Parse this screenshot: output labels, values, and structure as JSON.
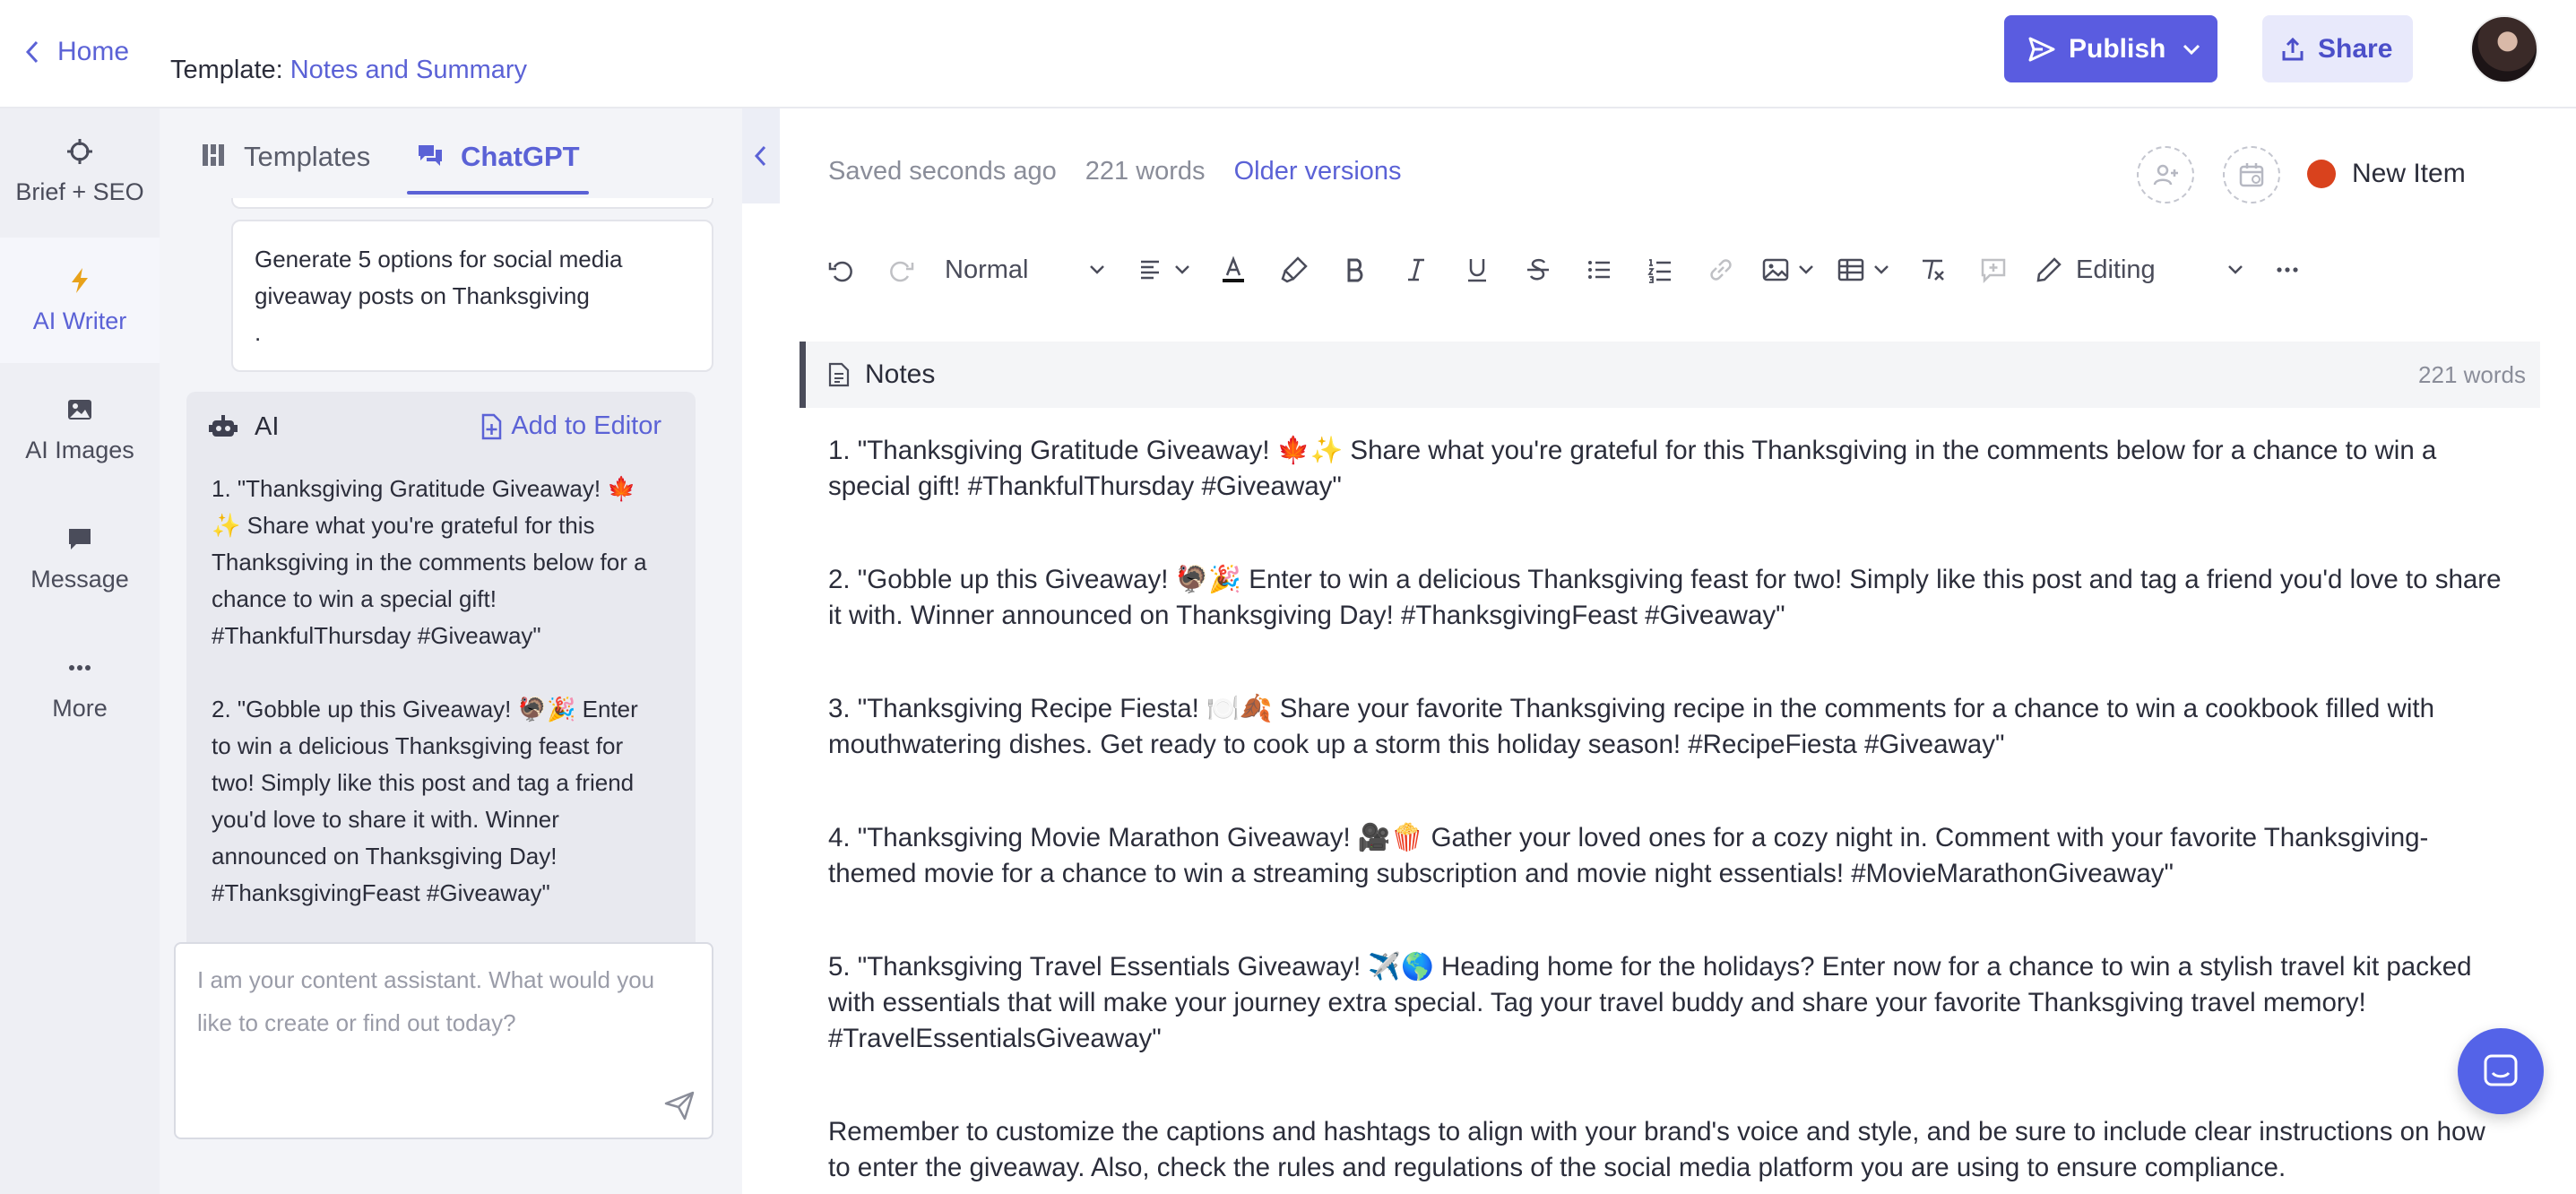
{
  "header": {
    "home_label": "Home",
    "template_prefix": "Template:",
    "template_name": "Notes and Summary",
    "publish_label": "Publish",
    "share_label": "Share"
  },
  "rail": {
    "items": [
      {
        "label": "Brief + SEO",
        "icon": "crosshair-icon"
      },
      {
        "label": "AI Writer",
        "icon": "lightning-icon"
      },
      {
        "label": "AI Images",
        "icon": "image-icon"
      },
      {
        "label": "Message",
        "icon": "chat-bubble-icon"
      },
      {
        "label": "More",
        "icon": "more-dots-icon"
      }
    ]
  },
  "chat": {
    "tabs": [
      "Templates",
      "ChatGPT"
    ],
    "user_message": "Generate 5 options for social media giveaway posts on Thanksgiving\n.",
    "ai_label": "AI",
    "add_to_editor_label": "Add to Editor",
    "ai_paragraphs": [
      "1. \"Thanksgiving Gratitude Giveaway! 🍁✨ Share what you're grateful for this Thanksgiving in the comments below for a chance to win a special gift! #ThankfulThursday #Giveaway\"",
      "2. \"Gobble up this Giveaway! 🦃🎉 Enter to win a delicious Thanksgiving feast for two! Simply like this post and tag a friend you'd love to share it with. Winner announced on Thanksgiving Day! #ThanksgivingFeast #Giveaway\""
    ],
    "input_placeholder": "I am your content assistant. What would you like to create or find out today?"
  },
  "editor": {
    "saved_status": "Saved seconds ago",
    "word_count": "221 words",
    "older_versions_label": "Older versions",
    "item_status": "New Item",
    "status_color": "#d9421d",
    "toolbar": {
      "text_style": "Normal",
      "mode": "Editing"
    },
    "section_title": "Notes",
    "section_word_count": "221 words",
    "paragraphs": [
      "1. \"Thanksgiving Gratitude Giveaway! 🍁✨ Share what you're grateful for this Thanksgiving in the comments below for a chance to win a special gift! #ThankfulThursday #Giveaway\"",
      "2. \"Gobble up this Giveaway! 🦃🎉 Enter to win a delicious Thanksgiving feast for two! Simply like this post and tag a friend you'd love to share it with. Winner announced on Thanksgiving Day! #ThanksgivingFeast #Giveaway\"",
      "3. \"Thanksgiving Recipe Fiesta! 🍽️🍂 Share your favorite Thanksgiving recipe in the comments for a chance to win a cookbook filled with mouthwatering dishes. Get ready to cook up a storm this holiday season! #RecipeFiesta #Giveaway\"",
      "4. \"Thanksgiving Movie Marathon Giveaway! 🎥🍿 Gather your loved ones for a cozy night in. Comment with your favorite Thanksgiving-themed movie for a chance to win a streaming subscription and movie night essentials! #MovieMarathonGiveaway\"",
      "5. \"Thanksgiving Travel Essentials Giveaway! ✈️🌎 Heading home for the holidays? Enter now for a chance to win a stylish travel kit packed with essentials that will make your journey extra special. Tag your travel buddy and share your favorite Thanksgiving travel memory! #TravelEssentialsGiveaway\"",
      "Remember to customize the captions and hashtags to align with your brand's voice and style, and be sure to include clear instructions on how to enter the giveaway. Also, check the rules and regulations of the social media platform you are using to ensure compliance."
    ]
  },
  "colors": {
    "accent": "#5b62d6",
    "publish_bg": "#5a5ce0",
    "share_bg": "#e8e9fb",
    "rail_bg": "#eeeff4",
    "panel_bg": "#f3f4f8"
  }
}
